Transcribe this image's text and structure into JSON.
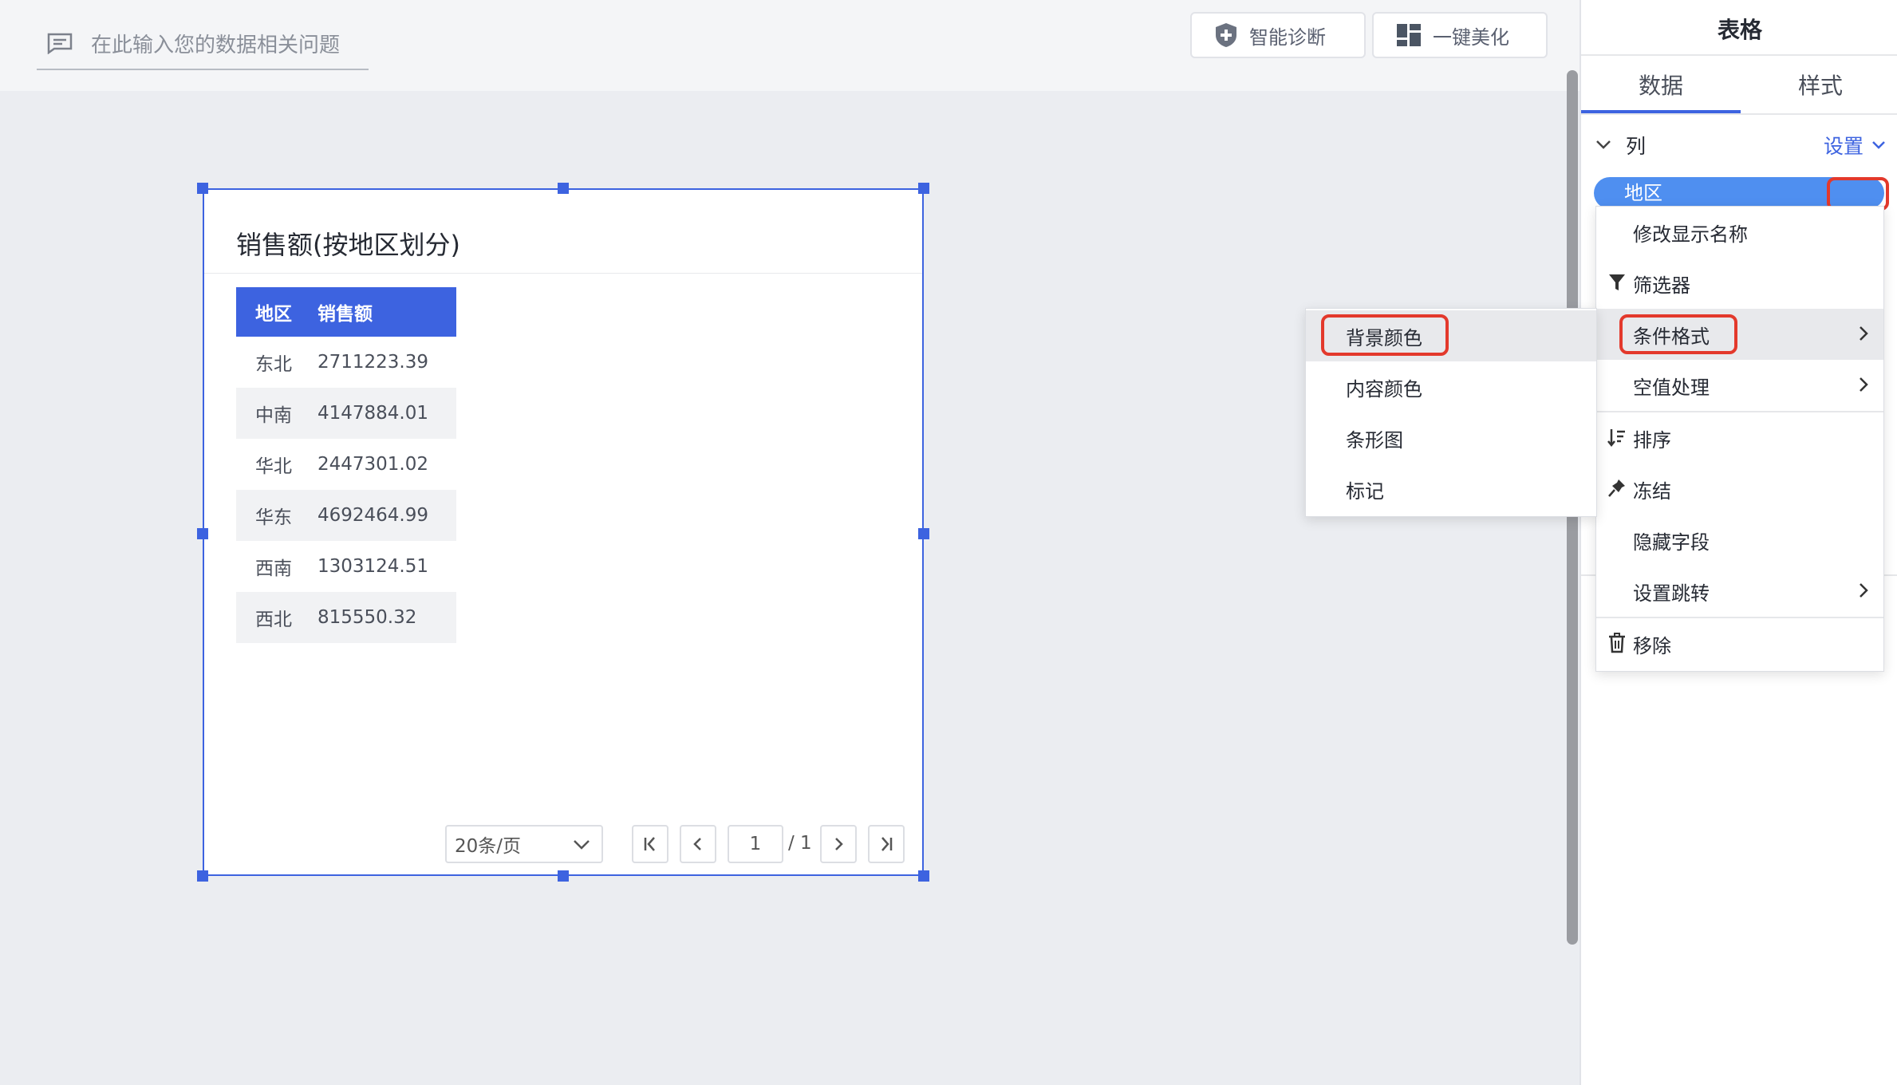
{
  "toolbar": {
    "ask_placeholder": "在此输入您的数据相关问题",
    "diagnose_label": "智能诊断",
    "beautify_label": "一键美化"
  },
  "card": {
    "title": "销售额(按地区划分)",
    "columns": [
      "地区",
      "销售额"
    ],
    "rows": [
      {
        "region": "东北",
        "sales": "2711223.39"
      },
      {
        "region": "中南",
        "sales": "4147884.01"
      },
      {
        "region": "华北",
        "sales": "2447301.02"
      },
      {
        "region": "华东",
        "sales": "4692464.99"
      },
      {
        "region": "西南",
        "sales": "1303124.51"
      },
      {
        "region": "西北",
        "sales": "815550.32"
      }
    ],
    "pager": {
      "page_size": "20条/页",
      "current_page": "1",
      "total_pages": "/ 1"
    }
  },
  "panel": {
    "title": "表格",
    "tabs": [
      "数据",
      "样式"
    ],
    "section_label": "列",
    "settings_link": "设置",
    "field_pill": "地区"
  },
  "context_menu": {
    "items": [
      "修改显示名称",
      "筛选器",
      "条件格式",
      "空值处理",
      "排序",
      "冻结",
      "隐藏字段",
      "设置跳转",
      "移除"
    ]
  },
  "submenu": {
    "items": [
      "背景颜色",
      "内容颜色",
      "条形图",
      "标记"
    ]
  },
  "colors": {
    "accent": "#3d63e0",
    "pill": "#4f8ff0",
    "highlight_box": "#e3392c"
  }
}
